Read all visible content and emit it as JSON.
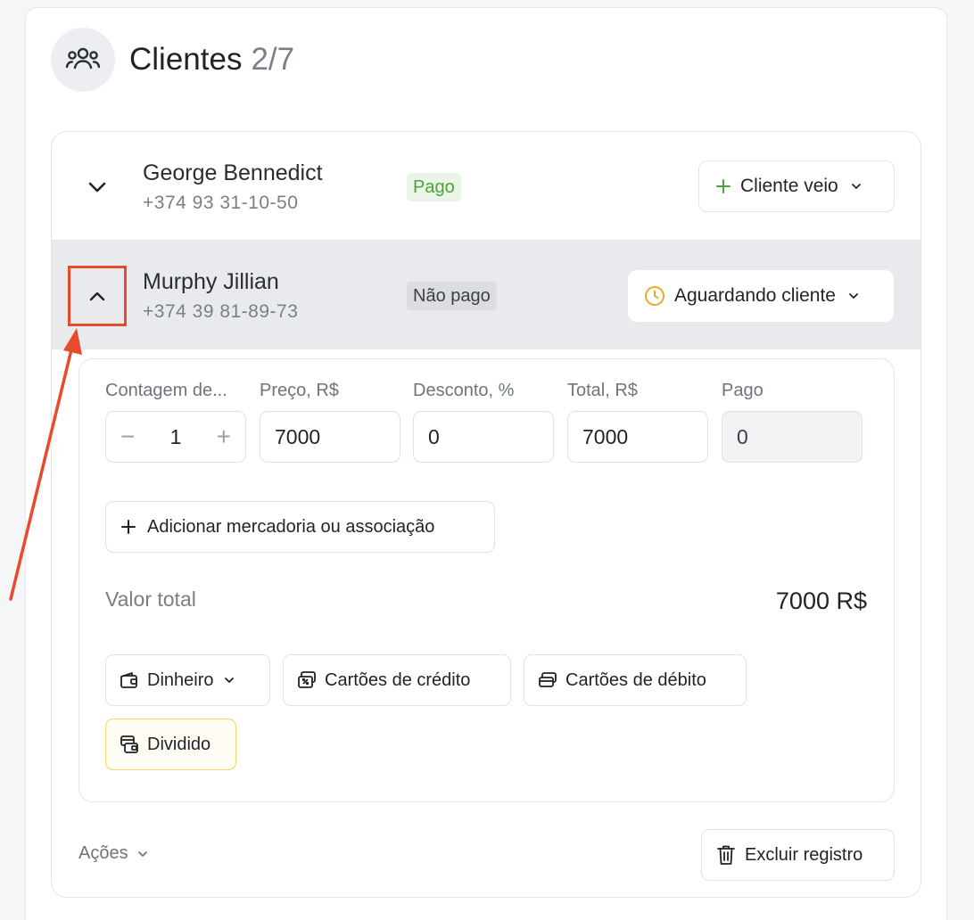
{
  "header": {
    "title": "Clientes",
    "count": "2/7",
    "icon": "users-icon"
  },
  "clients": [
    {
      "name": "George Bennedict",
      "phone": "+374 93 31-10-50",
      "payment_badge": "Pago",
      "status_label": "Cliente veio",
      "status_icon": "plus-icon",
      "expanded": false
    },
    {
      "name": "Murphy Jillian",
      "phone": "+374 39 81-89-73",
      "payment_badge": "Não pago",
      "status_label": "Aguardando cliente",
      "status_icon": "clock-icon",
      "expanded": true
    }
  ],
  "detail": {
    "fields": {
      "quantity": {
        "label": "Contagem de...",
        "value": "1",
        "minus": "−",
        "plus": "+"
      },
      "price": {
        "label": "Preço, R$",
        "value": "7000"
      },
      "discount": {
        "label": "Desconto, %",
        "value": "0"
      },
      "total": {
        "label": "Total, R$",
        "value": "7000"
      },
      "paid": {
        "label": "Pago",
        "value": "0"
      }
    },
    "add_item_label": "Adicionar mercadoria ou associação",
    "total_label": "Valor total",
    "total_value": "7000 R$",
    "payment_methods": [
      {
        "label": "Dinheiro",
        "icon": "wallet-icon",
        "has_dropdown": true
      },
      {
        "label": "Cartões de crédito",
        "icon": "credit-card-icon"
      },
      {
        "label": "Cartões de débito",
        "icon": "debit-card-icon"
      },
      {
        "label": "Dividido",
        "icon": "split-icon",
        "selected": true
      }
    ]
  },
  "footer": {
    "actions_label": "Ações",
    "delete_label": "Excluir registro"
  },
  "colors": {
    "accent_red": "#e84a2e",
    "paid_green": "#4aa33b",
    "pending_amber": "#f0a927",
    "split_border": "#f3d36b"
  }
}
